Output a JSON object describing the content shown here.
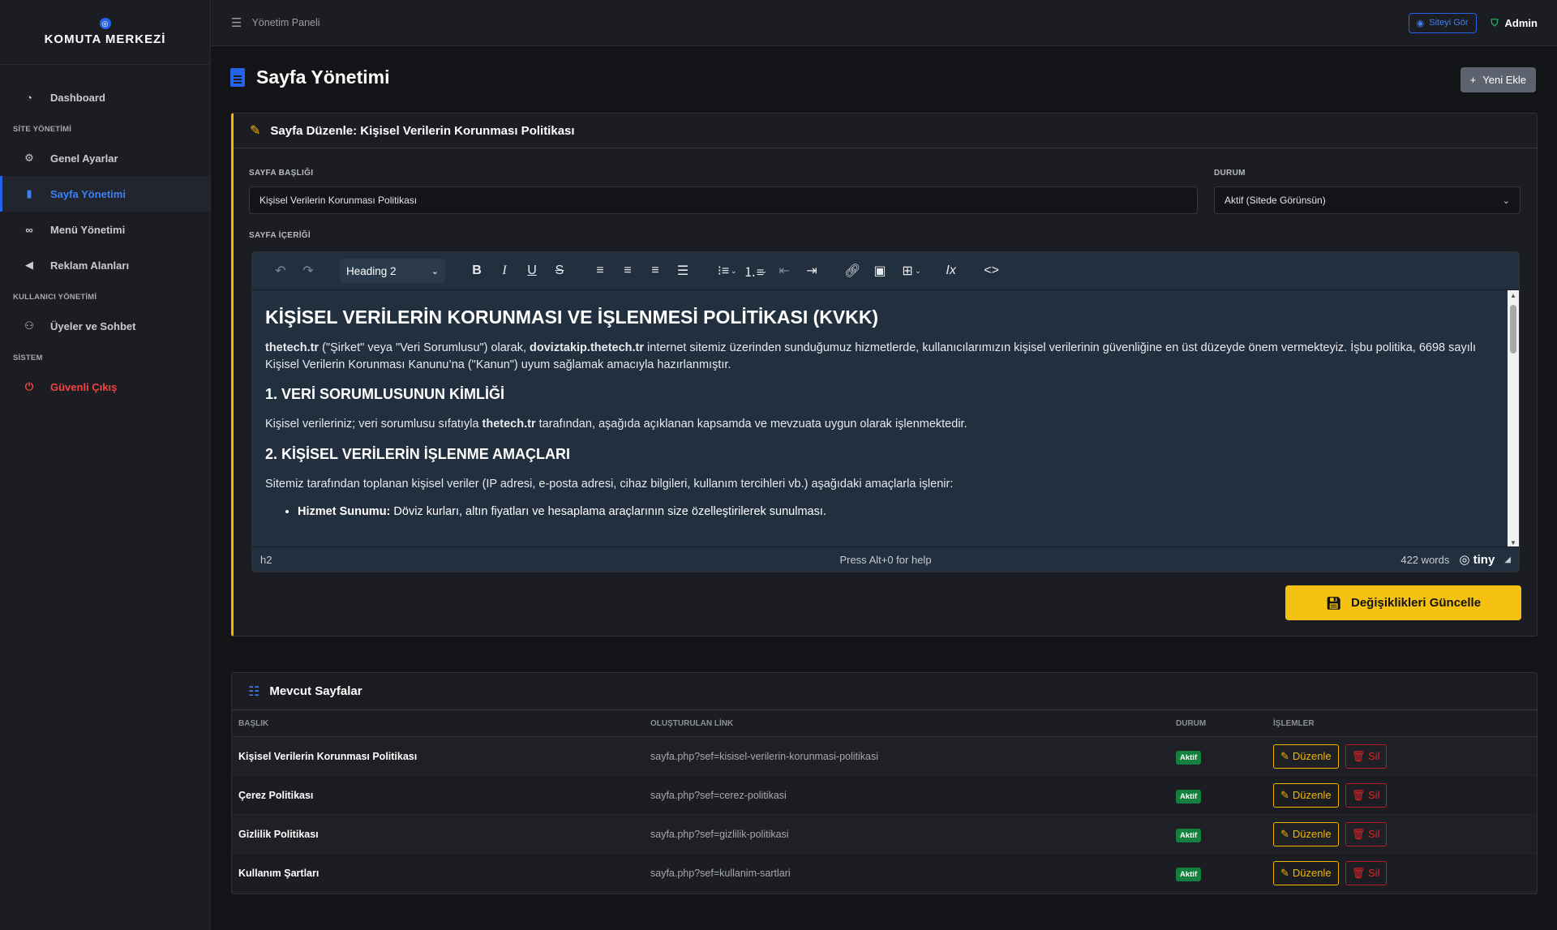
{
  "brand": {
    "title": "KOMUTA MERKEZİ",
    "icon": "compass-icon"
  },
  "sidebar": {
    "dashboard": "Dashboard",
    "section_site": "SİTE YÖNETİMİ",
    "genel_ayarlar": "Genel Ayarlar",
    "sayfa_yonetimi": "Sayfa Yönetimi",
    "menu_yonetimi": "Menü Yönetimi",
    "reklam_alanlari": "Reklam Alanları",
    "section_users": "KULLANICI YÖNETİMİ",
    "uyeler": "Üyeler ve Sohbet",
    "section_system": "SİSTEM",
    "cikis": "Güvenli Çıkış"
  },
  "topbar": {
    "breadcrumb": "Yönetim Paneli",
    "view_site": "Siteyi Gör",
    "user": "Admin"
  },
  "page": {
    "title": "Sayfa Yönetimi",
    "new_button": "Yeni Ekle"
  },
  "edit": {
    "header": "Sayfa Düzenle: Kişisel Verilerin Korunması Politikası",
    "title_label": "SAYFA BAŞLIĞI",
    "title_value": "Kişisel Verilerin Korunması Politikası",
    "status_label": "DURUM",
    "status_value": "Aktif (Sitede Görünsün)",
    "content_label": "SAYFA İÇERİĞİ",
    "save_button": "Değişiklikleri Güncelle"
  },
  "editor": {
    "format_select": "Heading 2",
    "status_path": "h2",
    "help": "Press Alt+0 for help",
    "word_count": "422 words",
    "brand": "tiny",
    "content": {
      "heading": "KİŞİSEL VERİLERİN KORUNMASI VE İŞLENMESİ POLİTİKASI (KVKK)",
      "p1_b1": "thetech.tr",
      "p1_t1": " (\"Şirket\" veya \"Veri Sorumlusu\") olarak, ",
      "p1_b2": "doviztakip.thetech.tr",
      "p1_t2": " internet sitemiz üzerinden sunduğumuz hizmetlerde, kullanıcılarımızın kişisel verilerinin güvenliğine en üst düzeyde önem vermekteyiz. İşbu politika, 6698 sayılı Kişisel Verilerin Korunması Kanunu’na (\"Kanun\") uyum sağlamak amacıyla hazırlanmıştır.",
      "h_1": "1. VERİ SORUMLUSUNUN KİMLİĞİ",
      "p2_t1": "Kişisel verileriniz; veri sorumlusu sıfatıyla ",
      "p2_b1": "thetech.tr",
      "p2_t2": " tarafından, aşağıda açıklanan kapsamda ve mevzuata uygun olarak işlenmektedir.",
      "h_2": "2. KİŞİSEL VERİLERİN İŞLENME AMAÇLARI",
      "p3": "Sitemiz tarafından toplanan kişisel veriler (IP adresi, e-posta adresi, cihaz bilgileri, kullanım tercihleri vb.) aşağıdaki amaçlarla işlenir:",
      "li1_b": "Hizmet Sunumu:",
      "li1_t": " Döviz kurları, altın fiyatları ve hesaplama araçlarının size özelleştirilerek sunulması."
    }
  },
  "pages": {
    "header": "Mevcut Sayfalar",
    "columns": [
      "BAŞLIK",
      "OLUŞTURULAN LİNK",
      "DURUM",
      "İŞLEMLER"
    ],
    "edit_label": "Düzenle",
    "delete_label": "Sil",
    "rows": [
      {
        "title": "Kişisel Verilerin Korunması Politikası",
        "link": "sayfa.php?sef=kisisel-verilerin-korunmasi-politikasi",
        "status": "Aktif"
      },
      {
        "title": "Çerez Politikası",
        "link": "sayfa.php?sef=cerez-politikasi",
        "status": "Aktif"
      },
      {
        "title": "Gizlilik Politikası",
        "link": "sayfa.php?sef=gizlilik-politikasi",
        "status": "Aktif"
      },
      {
        "title": "Kullanım Şartları",
        "link": "sayfa.php?sef=kullanim-sartlari",
        "status": "Aktif"
      }
    ]
  },
  "colors": {
    "accent": "#2563eb",
    "warning": "#f5b400",
    "danger": "#dc2626",
    "success": "#15803d"
  }
}
